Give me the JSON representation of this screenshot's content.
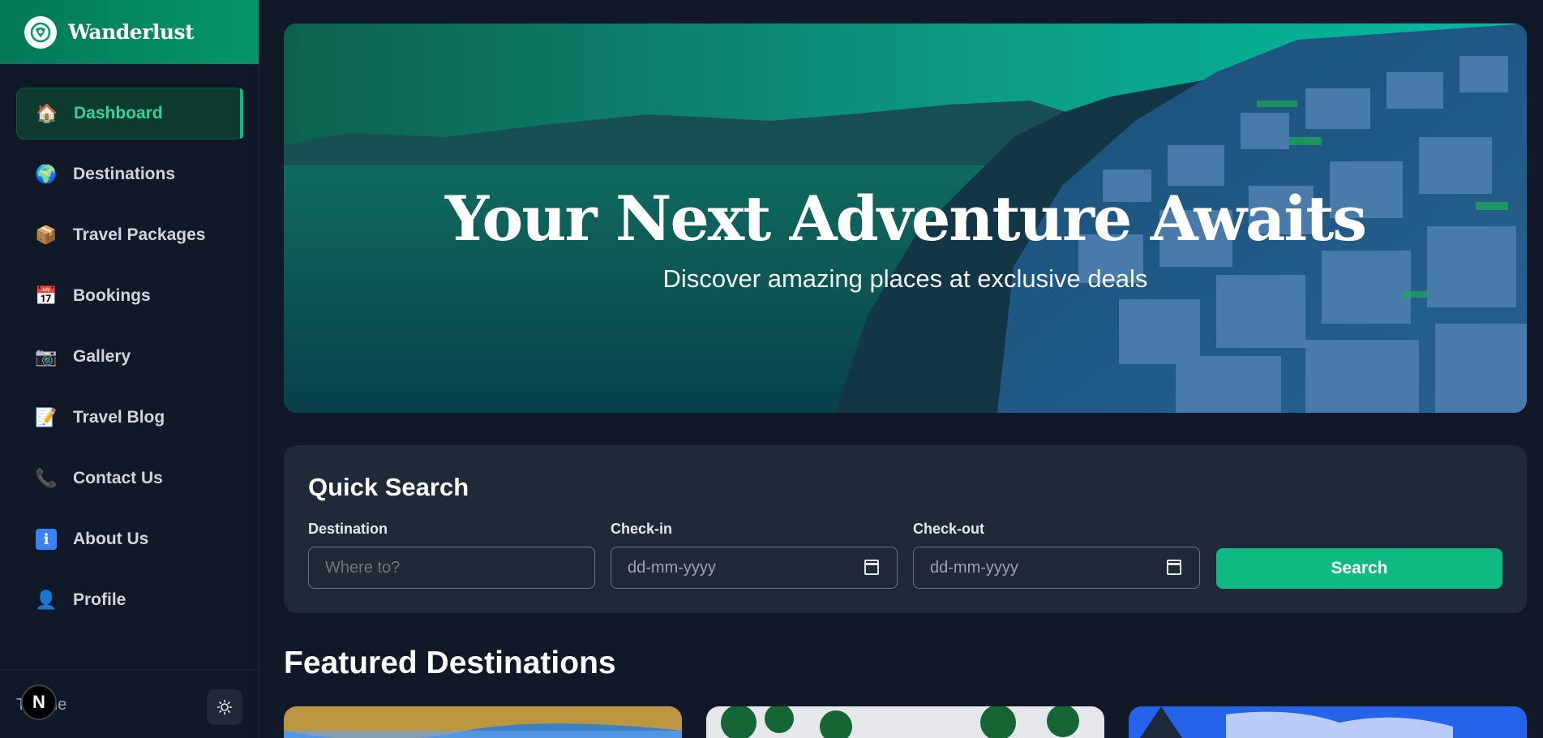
{
  "brand": {
    "name": "Wanderlust",
    "logo_icon": "globe-leaf-icon"
  },
  "sidebar": {
    "items": [
      {
        "label": "Dashboard",
        "icon": "🏠",
        "active": true
      },
      {
        "label": "Destinations",
        "icon": "🌍"
      },
      {
        "label": "Travel Packages",
        "icon": "📦"
      },
      {
        "label": "Bookings",
        "icon": "📅"
      },
      {
        "label": "Gallery",
        "icon": "📷"
      },
      {
        "label": "Travel Blog",
        "icon": "📝"
      },
      {
        "label": "Contact Us",
        "icon": "📞"
      },
      {
        "label": "About Us",
        "icon": "ℹ"
      },
      {
        "label": "Profile",
        "icon": "👤"
      }
    ],
    "footer": {
      "theme_label": "Theme",
      "n_badge": "N",
      "toggle_icon": "sun-icon"
    }
  },
  "hero": {
    "title": "Your Next Adventure Awaits",
    "subtitle": "Discover amazing places at exclusive deals"
  },
  "quick_search": {
    "title": "Quick Search",
    "destination_label": "Destination",
    "destination_placeholder": "Where to?",
    "checkin_label": "Check-in",
    "checkin_placeholder": "dd-mm-yyyy",
    "checkout_label": "Check-out",
    "checkout_placeholder": "dd-mm-yyyy",
    "search_label": "Search"
  },
  "featured": {
    "title": "Featured Destinations"
  },
  "colors": {
    "accent": "#10b981",
    "bg": "#111827",
    "panel": "#1f2937"
  }
}
